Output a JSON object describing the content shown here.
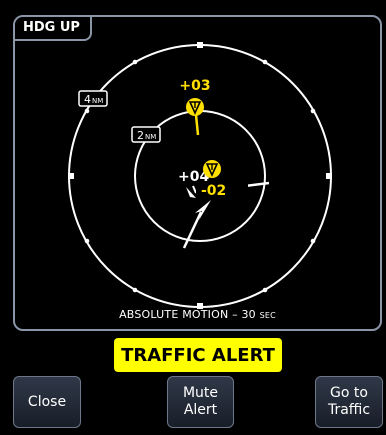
{
  "display": {
    "orientation": "HDG UP",
    "motion_mode": "ABSOLUTE MOTION – 30",
    "motion_unit": "SEC"
  },
  "rings": {
    "outer": {
      "value": "4",
      "unit": "NM"
    },
    "inner": {
      "value": "2",
      "unit": "NM"
    }
  },
  "targets": [
    {
      "altitude": "+03",
      "color": "#ffe000"
    },
    {
      "altitude": "-02",
      "color": "#ffe000"
    },
    {
      "altitude": "+04",
      "color": "#ffffff"
    }
  ],
  "alert": {
    "text": "TRAFFIC ALERT",
    "color": "#ffff00"
  },
  "buttons": {
    "close": "Close",
    "mute": "Mute\nAlert",
    "goto": "Go to\nTraffic"
  }
}
